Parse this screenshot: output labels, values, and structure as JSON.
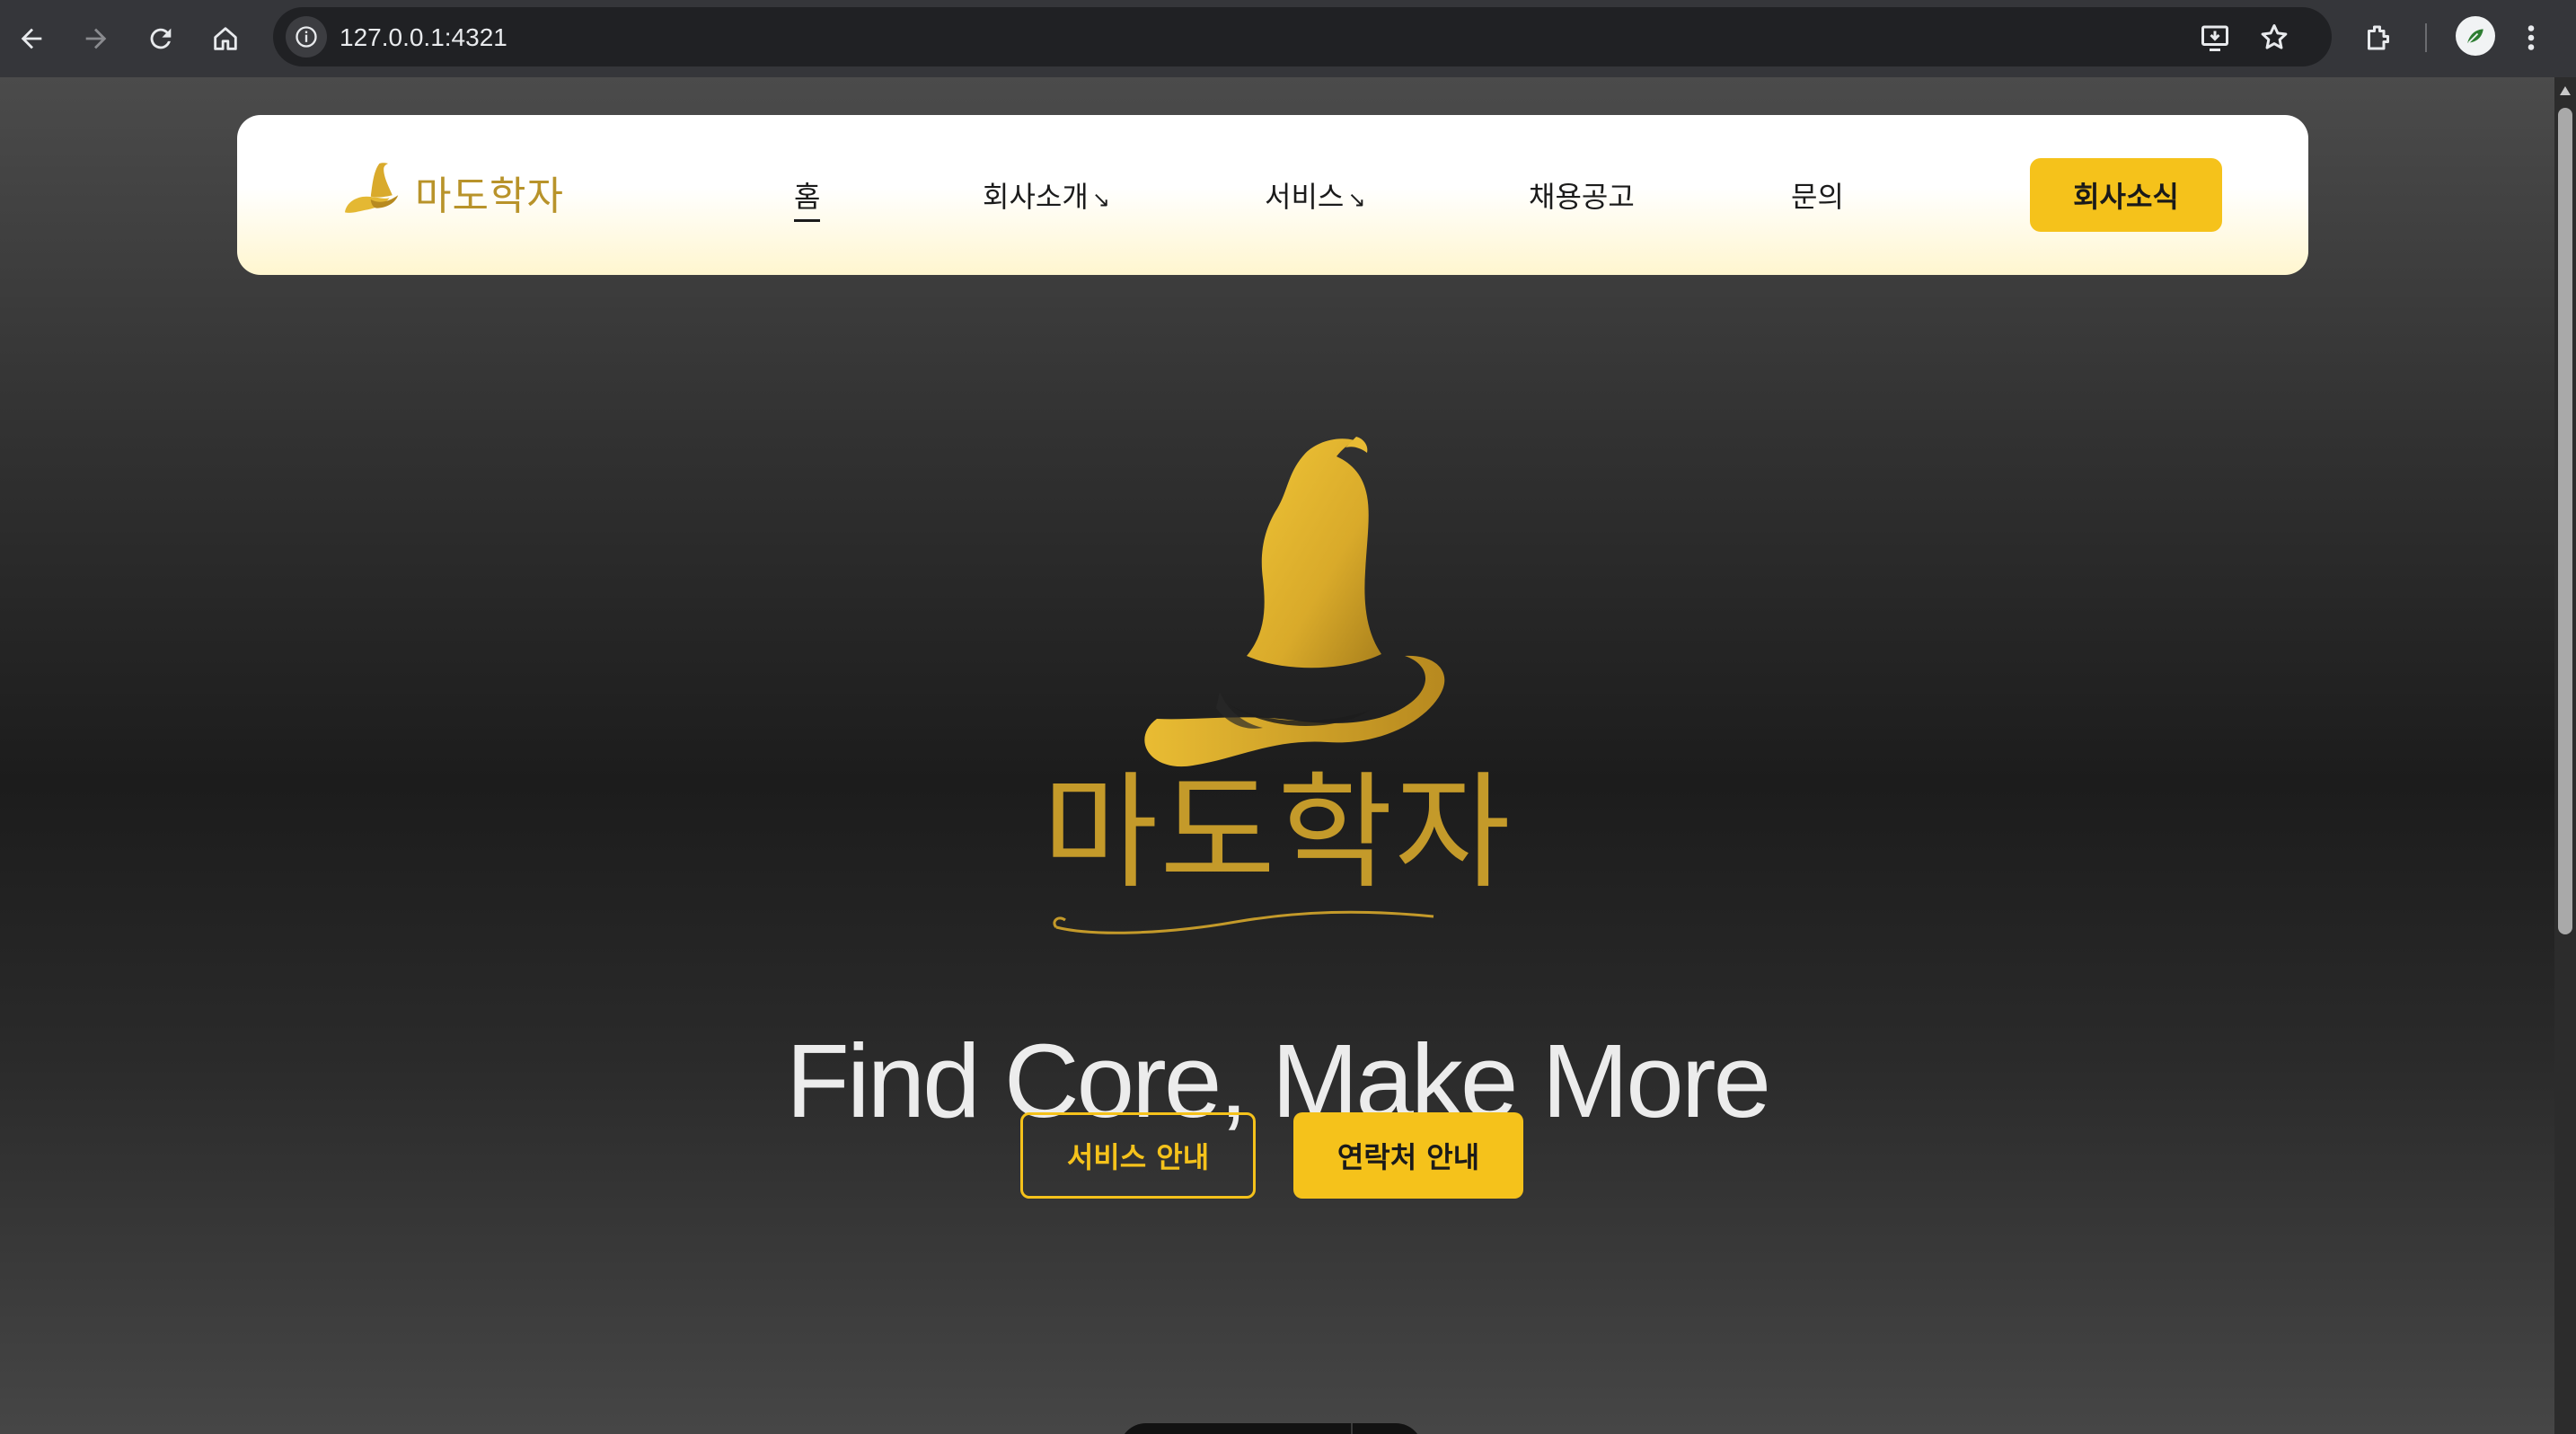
{
  "browser": {
    "url": "127.0.0.1:4321",
    "icons": [
      "back-arrow-icon",
      "forward-arrow-icon",
      "reload-icon",
      "home-icon",
      "site-info-icon",
      "install-app-icon",
      "bookmark-star-icon",
      "extensions-icon",
      "profile-avatar",
      "more-menu-icon"
    ]
  },
  "header": {
    "brand_name": "마도학자",
    "menu": [
      {
        "label": "홈",
        "has_submenu": false,
        "active": true
      },
      {
        "label": "회사소개",
        "has_submenu": true,
        "arrow": "↘"
      },
      {
        "label": "서비스",
        "has_submenu": true,
        "arrow": "↘"
      },
      {
        "label": "채용공고",
        "has_submenu": false
      },
      {
        "label": "문의",
        "has_submenu": false
      }
    ],
    "cta_label": "회사소식"
  },
  "hero": {
    "brand_name": "마도학자",
    "tagline": "Find Core, Make More",
    "primary_outline_label": "서비스 안내",
    "primary_solid_label": "연락처 안내"
  },
  "colors": {
    "accent": "#f5c21b",
    "gold": "#c49a2a",
    "chrome_bg": "#35363a",
    "omnibox_bg": "#202124"
  }
}
